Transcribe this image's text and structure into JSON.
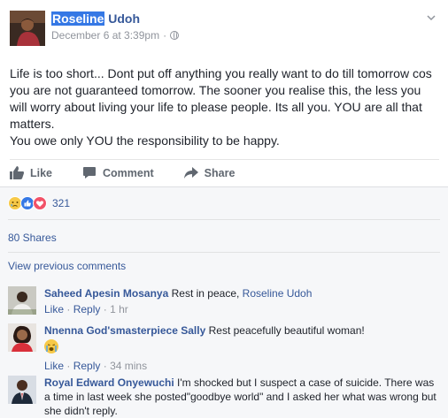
{
  "post": {
    "author_first": "Roseline",
    "author_last": "Udoh",
    "date": "December 6 at 3:39pm",
    "dot": "·",
    "privacy_icon": "globe-icon",
    "menu_icon": "chevron-down-icon",
    "text_lines": [
      "Life is too short... Dont put off anything you really want to do till tomorrow cos you are not guaranteed tomorrow. The sooner you realise this, the less you will worry about living your life to please people. Its all you. YOU are all that matters.",
      "You owe only YOU the responsibility to be happy."
    ]
  },
  "actions": {
    "like": "Like",
    "comment": "Comment",
    "share": "Share"
  },
  "reactions": {
    "icons": [
      "sad-reaction-icon",
      "like-reaction-icon",
      "love-reaction-icon"
    ],
    "count": "321"
  },
  "shares": "80 Shares",
  "view_previous": "View previous comments",
  "comments": [
    {
      "name": "Saheed Apesin Mosanya",
      "text": " Rest in peace, ",
      "mention": "Roseline Udoh",
      "like": "Like",
      "reply": "Reply",
      "sep": "·",
      "time": "1 hr"
    },
    {
      "name": "Nnenna God'smasterpiece Sally",
      "text": " Rest peacefully beautiful woman!",
      "emoji": "crying-emoji-icon",
      "like": "Like",
      "reply": "Reply",
      "sep": "·",
      "time": "34 mins"
    },
    {
      "name": "Royal Edward Onyewuchi",
      "text": " I'm shocked but I suspect a case of suicide. There was a time in last week she posted\"goodbye world\" and I asked her what was wrong but she didn't reply."
    }
  ],
  "colors": {
    "link": "#365899",
    "highlight": "#3578e5",
    "text": "#1d2129",
    "meta": "#90949c"
  }
}
